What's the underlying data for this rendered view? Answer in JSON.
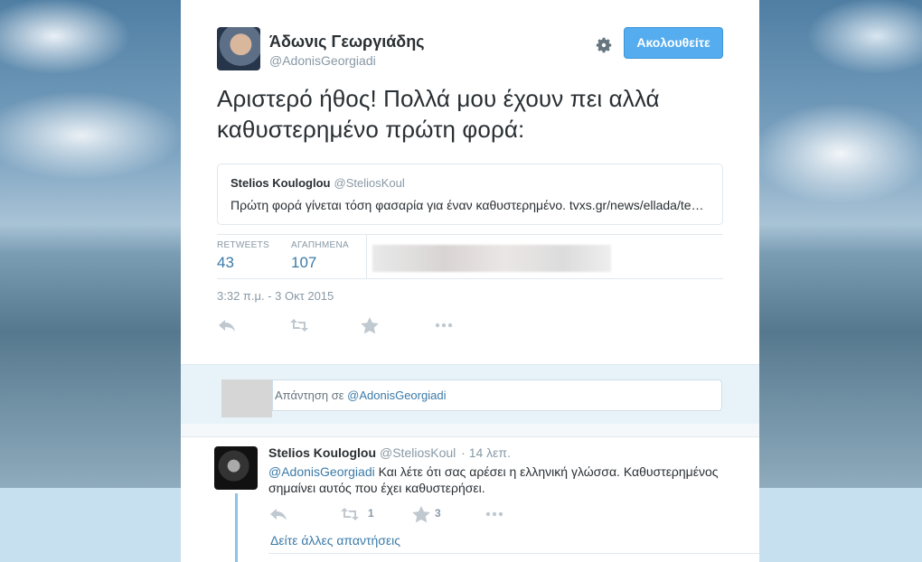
{
  "tweet": {
    "author_name": "Άδωνις Γεωργιάδης",
    "author_handle": "@AdonisGeorgiadi",
    "follow_label": "Ακολουθείτε",
    "text_line1": "Αριστερό ήθος! Πολλά μου έχουν πει αλλά",
    "text_line2": "καθυστερημένο πρώτη φορά:",
    "quote": {
      "name": "Stelios Kouloglou",
      "handle": "@SteliosKoul",
      "text": "Πρώτη φορά γίνεται τόση φασαρία για έναν καθυστερημένο. tvxs.gr/news/ellada/te…"
    },
    "stats": {
      "retweets_label": "RETWEETS",
      "retweets_value": "43",
      "likes_label": "ΑΓΑΠΗΜΕΝΑ",
      "likes_value": "107"
    },
    "timestamp": "3:32 π.μ. - 3 Οκτ 2015",
    "actions": [
      "reply-icon",
      "retweet-icon",
      "favorite-icon",
      "more-icon"
    ]
  },
  "reply_box": {
    "prefix": "Απάντηση σε ",
    "mention": "@AdonisGeorgiadi"
  },
  "reply": {
    "name": "Stelios Kouloglou",
    "handle": "@SteliosKoul",
    "time": "· 14 λεπ.",
    "mention": "@AdonisGeorgiadi",
    "text_rest": " Και λέτε ότι σας αρέσει η ελληνική γλώσσα. Καθυστερημένος σημαίνει αυτός που έχει καθυστερήσει.",
    "retweet_count": "1",
    "favorite_count": "3",
    "more_replies": "Δείτε άλλες απαντήσεις"
  },
  "colors": {
    "link": "#3b7aa8",
    "follow_button": "#55acee",
    "muted": "#8899a6"
  }
}
